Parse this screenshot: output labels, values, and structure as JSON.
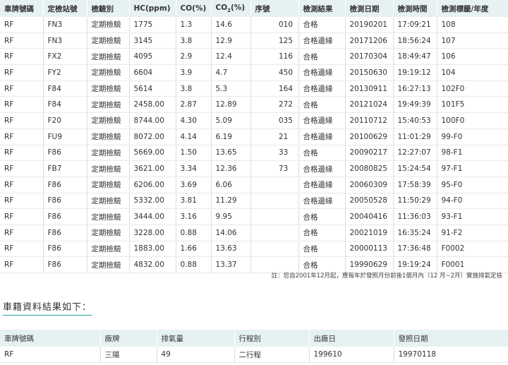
{
  "inspection": {
    "headers": {
      "plate": "車牌號碼",
      "station": "定檢站號",
      "type": "檢驗別",
      "hc": "HC(ppm)",
      "co": "CO(%)",
      "co2_prefix": "CO",
      "co2_sub": "2",
      "co2_suffix": "(%)",
      "seq": "序號",
      "result": "檢測結果",
      "date": "檢測日期",
      "time": "檢測時間",
      "label": "檢測標籤/年度"
    },
    "rows": [
      {
        "plate": "RF",
        "station": "FN3",
        "type": "定期檢驗",
        "hc": "1775",
        "co": "1.3",
        "co2": "14.6",
        "seq": "010",
        "result": "合格",
        "date": "20190201",
        "time": "17:09:21",
        "label": "108"
      },
      {
        "plate": "RF",
        "station": "FN3",
        "type": "定期檢驗",
        "hc": "3145",
        "co": "3.8",
        "co2": "12.9",
        "seq": "125",
        "result": "合格邊緣",
        "date": "20171206",
        "time": "18:56:24",
        "label": "107"
      },
      {
        "plate": "RF",
        "station": "FX2",
        "type": "定期檢驗",
        "hc": "4095",
        "co": "2.9",
        "co2": "12.4",
        "seq": "116",
        "result": "合格",
        "date": "20170304",
        "time": "18:49:47",
        "label": "106"
      },
      {
        "plate": "RF",
        "station": "FY2",
        "type": "定期檢驗",
        "hc": "6604",
        "co": "3.9",
        "co2": "4.7",
        "seq": "450",
        "result": "合格邊緣",
        "date": "20150630",
        "time": "19:19:12",
        "label": "104"
      },
      {
        "plate": "RF",
        "station": "F84",
        "type": "定期檢驗",
        "hc": "5614",
        "co": "3.8",
        "co2": "5.3",
        "seq": "164",
        "result": "合格邊緣",
        "date": "20130911",
        "time": "16:27:13",
        "label": "102F0"
      },
      {
        "plate": "RF",
        "station": "F84",
        "type": "定期檢驗",
        "hc": "2458.00",
        "co": "2.87",
        "co2": "12.89",
        "seq": "272",
        "result": "合格",
        "date": "20121024",
        "time": "19:49:39",
        "label": "101F5"
      },
      {
        "plate": "RF",
        "station": "F20",
        "type": "定期檢驗",
        "hc": "8744.00",
        "co": "4.30",
        "co2": "5.09",
        "seq": "035",
        "result": "合格邊緣",
        "date": "20110712",
        "time": "15:40:53",
        "label": "100F0"
      },
      {
        "plate": "RF",
        "station": "FU9",
        "type": "定期檢驗",
        "hc": "8072.00",
        "co": "4.14",
        "co2": "6.19",
        "seq": "21",
        "result": "合格邊緣",
        "date": "20100629",
        "time": "11:01:29",
        "label": "99-F0"
      },
      {
        "plate": "RF",
        "station": "F86",
        "type": "定期檢驗",
        "hc": "5669.00",
        "co": "1.50",
        "co2": "13.65",
        "seq": "33",
        "result": "合格",
        "date": "20090217",
        "time": "12:27:07",
        "label": "98-F1"
      },
      {
        "plate": "RF",
        "station": "FB7",
        "type": "定期檢驗",
        "hc": "3621.00",
        "co": "3.34",
        "co2": "12.36",
        "seq": "73",
        "result": "合格邊緣",
        "date": "20080825",
        "time": "15:24:54",
        "label": "97-F1"
      },
      {
        "plate": "RF",
        "station": "F86",
        "type": "定期檢驗",
        "hc": "6206.00",
        "co": "3.69",
        "co2": "6.06",
        "seq": "",
        "result": "合格邊緣",
        "date": "20060309",
        "time": "17:58:39",
        "label": "95-F0"
      },
      {
        "plate": "RF",
        "station": "F86",
        "type": "定期檢驗",
        "hc": "5332.00",
        "co": "3.81",
        "co2": "11.29",
        "seq": "",
        "result": "合格邊緣",
        "date": "20050528",
        "time": "11:50:29",
        "label": "94-F0"
      },
      {
        "plate": "RF",
        "station": "F86",
        "type": "定期檢驗",
        "hc": "3444.00",
        "co": "3.16",
        "co2": "9.95",
        "seq": "",
        "result": "合格",
        "date": "20040416",
        "time": "11:36:03",
        "label": "93-F1"
      },
      {
        "plate": "RF",
        "station": "F86",
        "type": "定期檢驗",
        "hc": "3228.00",
        "co": "0.88",
        "co2": "14.06",
        "seq": "",
        "result": "合格",
        "date": "20021019",
        "time": "16:35:24",
        "label": "91-F2"
      },
      {
        "plate": "RF",
        "station": "F86",
        "type": "定期檢驗",
        "hc": "1883.00",
        "co": "1.66",
        "co2": "13.63",
        "seq": "",
        "result": "合格",
        "date": "20000113",
        "time": "17:36:48",
        "label": "F0002"
      },
      {
        "plate": "RF",
        "station": "F86",
        "type": "定期檢驗",
        "hc": "4832.00",
        "co": "0.88",
        "co2": "13.37",
        "seq": "",
        "result": "合格",
        "date": "19990629",
        "time": "19:19:24",
        "label": "F0001"
      }
    ],
    "note": "註：您自2001年12月起，應每年於發照月份前後1個月內（12 月~2月）實施排氣定檢"
  },
  "registration": {
    "title": "車籍資料結果如下：",
    "headers": {
      "plate": "車牌號碼",
      "brand": "廠牌",
      "displacement": "排氣量",
      "stroke": "行程別",
      "made": "出廠日",
      "issued": "發照日期"
    },
    "row": {
      "plate": "RF",
      "brand": "三陽",
      "displacement": "49",
      "stroke": "二行程",
      "made": "199610",
      "issued": "19970118"
    }
  }
}
